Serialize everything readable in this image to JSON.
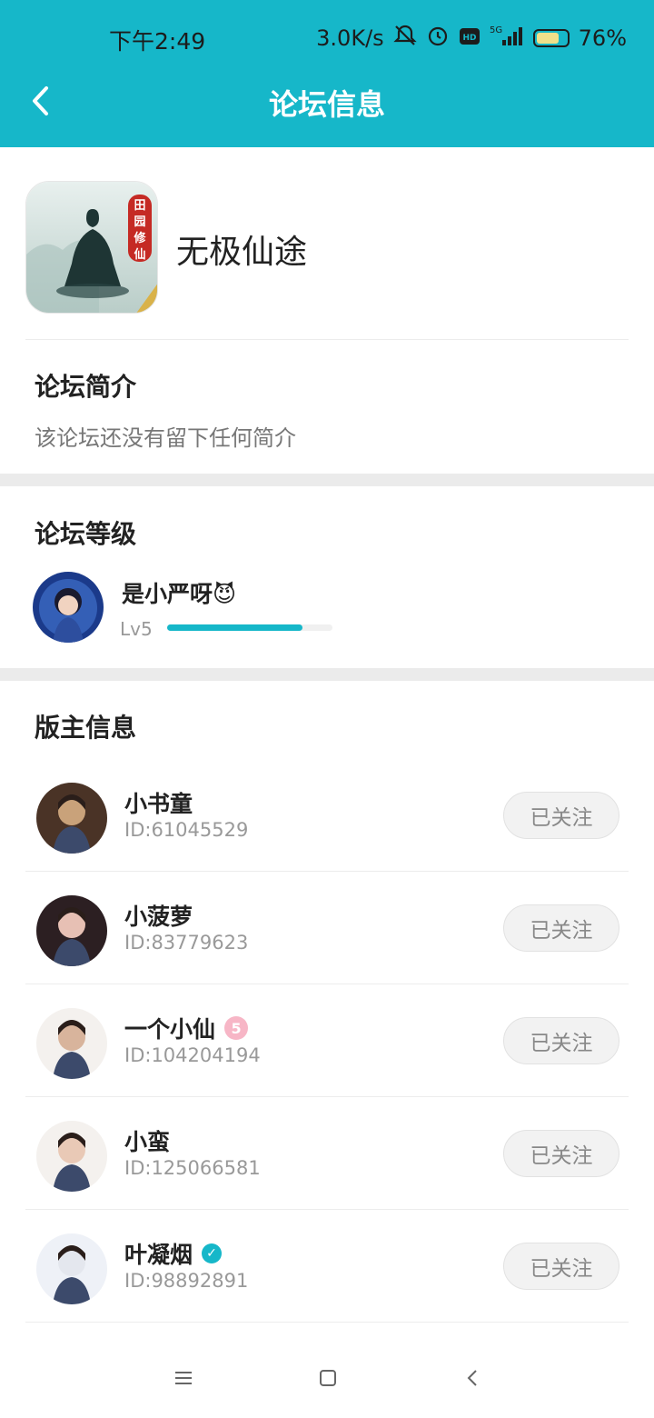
{
  "status_bar": {
    "time": "下午2:49",
    "network_speed": "3.0K/s",
    "icons": [
      "mute-bell-icon",
      "alarm-icon",
      "hd-icon",
      "signal-5g-icon"
    ],
    "battery_percent": "76%",
    "battery_level": 0.76
  },
  "nav": {
    "title": "论坛信息",
    "back_icon": "chevron-left-icon"
  },
  "forum": {
    "name": "无极仙途",
    "icon_badge_text": "田园修仙"
  },
  "intro": {
    "title": "论坛简介",
    "text": "该论坛还没有留下任何简介"
  },
  "level": {
    "title": "论坛等级",
    "user_name": "是小严呀",
    "user_emoji": "😈",
    "level_label": "Lv5",
    "progress": 0.82
  },
  "moderators": {
    "title": "版主信息",
    "items": [
      {
        "name": "小书童",
        "id": "ID:61045529",
        "button": "已关注",
        "badge": ""
      },
      {
        "name": "小菠萝",
        "id": "ID:83779623",
        "button": "已关注",
        "badge": ""
      },
      {
        "name": "一个小仙",
        "id": "ID:104204194",
        "button": "已关注",
        "badge": "5"
      },
      {
        "name": "小蛮",
        "id": "ID:125066581",
        "button": "已关注",
        "badge": ""
      },
      {
        "name": "叶凝烟",
        "id": "ID:98892891",
        "button": "已关注",
        "badge": "✓"
      }
    ]
  },
  "colors": {
    "accent": "#16b7c9",
    "background": "#ffffff",
    "divider": "#ececec"
  },
  "system_nav": {
    "icons": [
      "menu-icon",
      "home-icon",
      "back-icon"
    ]
  }
}
